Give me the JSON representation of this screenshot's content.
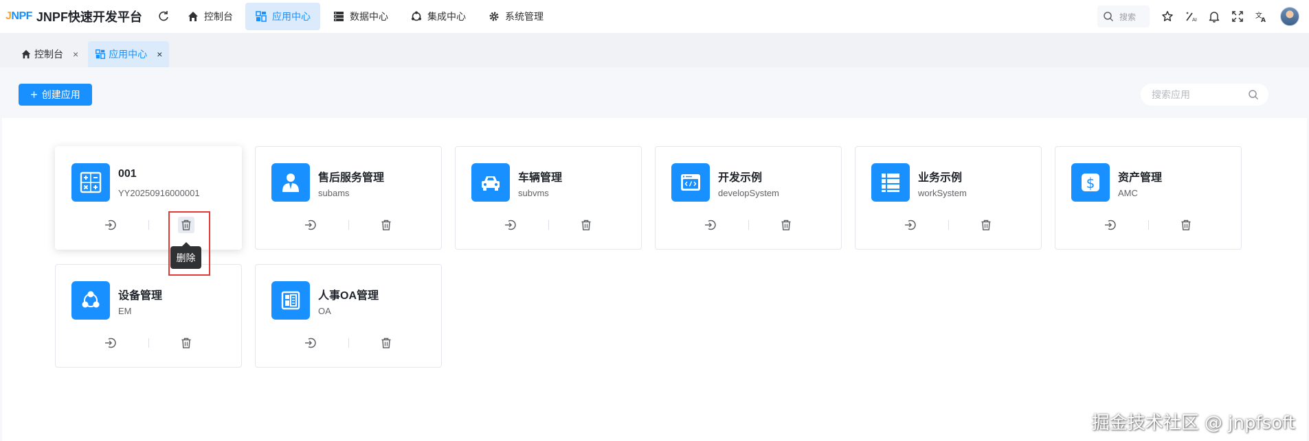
{
  "header": {
    "logo_mark_j": "J",
    "logo_mark_n": "N",
    "logo_mark_pf": "PF",
    "logo_title": "JNPF快速开发平台",
    "nav": [
      {
        "label": "控制台",
        "icon": "home-icon"
      },
      {
        "label": "应用中心",
        "icon": "app-grid-icon",
        "active": true
      },
      {
        "label": "数据中心",
        "icon": "database-icon"
      },
      {
        "label": "集成中心",
        "icon": "integration-icon"
      },
      {
        "label": "系统管理",
        "icon": "gear-icon"
      }
    ],
    "search_placeholder": "搜索",
    "icons": [
      "star-icon",
      "magic-wand-icon",
      "bell-icon",
      "fullscreen-icon",
      "translate-icon"
    ]
  },
  "tabs": [
    {
      "label": "控制台",
      "icon": "home-icon",
      "close": "×"
    },
    {
      "label": "应用中心",
      "icon": "app-grid-icon",
      "close": "×",
      "active": true
    }
  ],
  "toolbar": {
    "create_label": "创建应用",
    "create_plus": "+",
    "search_placeholder": "搜索应用"
  },
  "apps": [
    {
      "title": "001",
      "code": "YY20250916000001",
      "icon": "calculator-icon"
    },
    {
      "title": "售后服务管理",
      "code": "subams",
      "icon": "person-icon"
    },
    {
      "title": "车辆管理",
      "code": "subvms",
      "icon": "car-icon"
    },
    {
      "title": "开发示例",
      "code": "developSystem",
      "icon": "code-window-icon"
    },
    {
      "title": "业务示例",
      "code": "workSystem",
      "icon": "list-icon"
    },
    {
      "title": "资产管理",
      "code": "AMC",
      "icon": "dollar-icon"
    },
    {
      "title": "设备管理",
      "code": "EM",
      "icon": "nodes-icon"
    },
    {
      "title": "人事OA管理",
      "code": "OA",
      "icon": "oa-panel-icon"
    }
  ],
  "tooltip": "删除",
  "watermark": "掘金技术社区 @ jnpfsoft",
  "colors": {
    "primary": "#1890ff",
    "nav_active_bg": "#dcebfb",
    "highlight": "#e53935"
  }
}
